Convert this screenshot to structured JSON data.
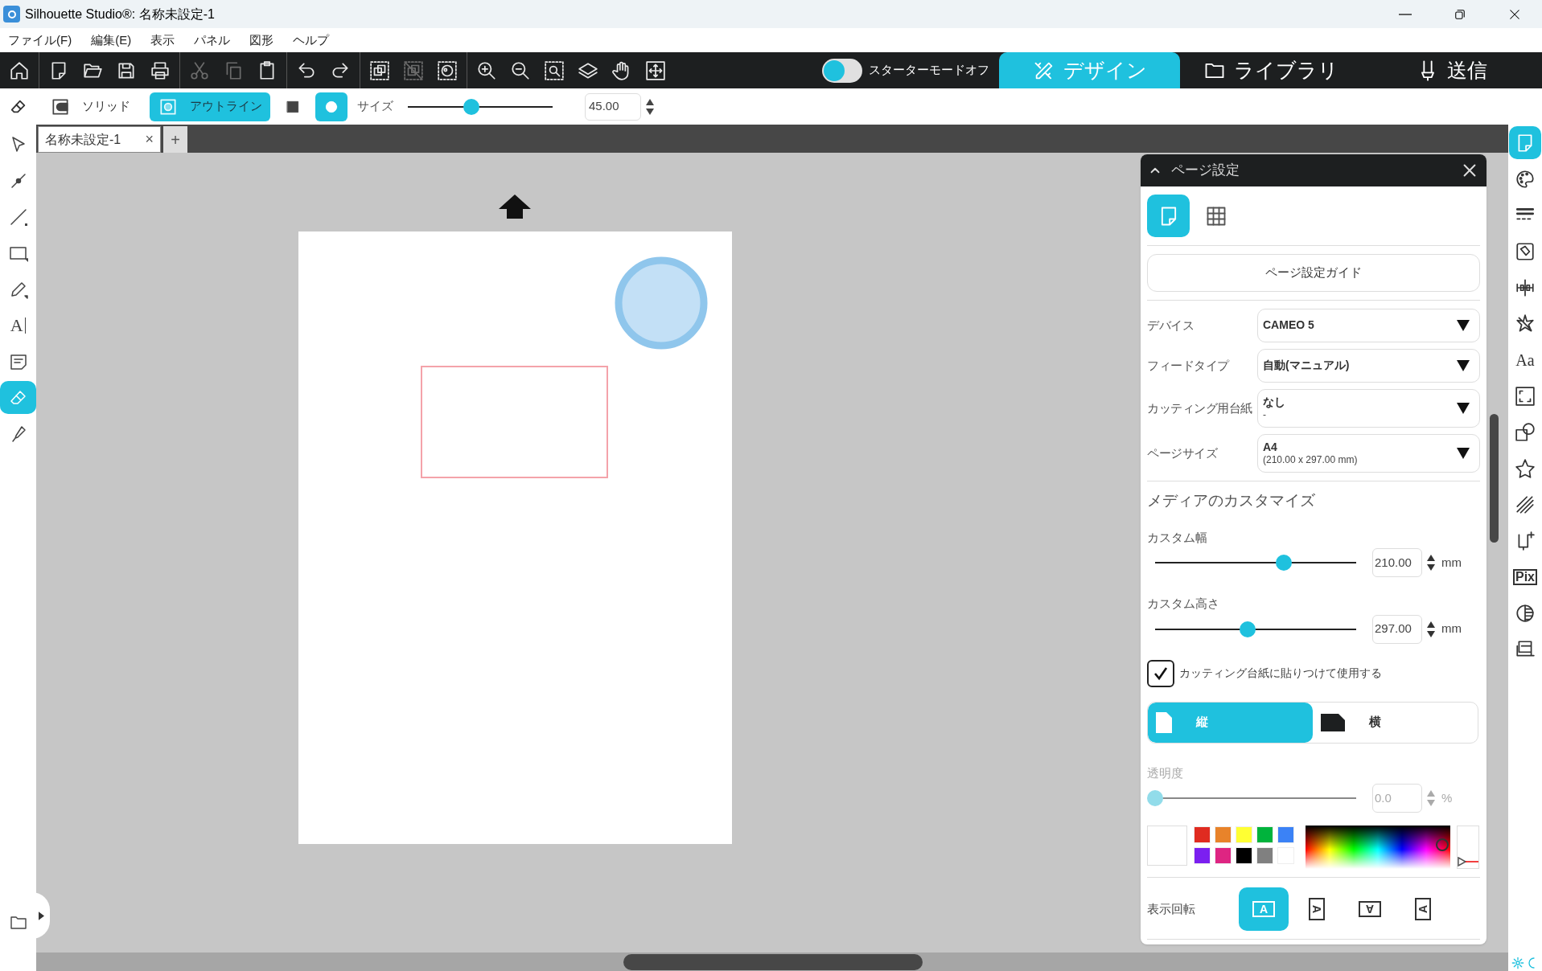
{
  "window": {
    "title": "Silhouette Studio®: 名称未設定-1"
  },
  "menu": [
    "ファイル(F)",
    "編集(E)",
    "表示",
    "パネル",
    "図形",
    "ヘルプ"
  ],
  "toolbar": [
    [
      {
        "kind": "home",
        "disabled": false
      }
    ],
    [
      {
        "kind": "new",
        "disabled": false
      },
      {
        "kind": "open",
        "disabled": false
      },
      {
        "kind": "save",
        "disabled": false
      },
      {
        "kind": "print",
        "disabled": false
      }
    ],
    [
      {
        "kind": "cut",
        "disabled": true
      },
      {
        "kind": "copy",
        "disabled": true
      },
      {
        "kind": "paste",
        "disabled": false
      }
    ],
    [
      {
        "kind": "undo",
        "disabled": false
      },
      {
        "kind": "redo",
        "disabled": false
      }
    ],
    [
      {
        "kind": "group",
        "disabled": false
      },
      {
        "kind": "ungroup",
        "disabled": true
      },
      {
        "kind": "compound",
        "disabled": false
      }
    ],
    [
      {
        "kind": "zoomin",
        "disabled": false
      },
      {
        "kind": "zoomout",
        "disabled": false
      },
      {
        "kind": "zoomsel",
        "disabled": false
      },
      {
        "kind": "flip",
        "disabled": false
      },
      {
        "kind": "hand",
        "disabled": false
      },
      {
        "kind": "fit",
        "disabled": false
      }
    ]
  ],
  "starter_mode": {
    "label": "スターターモードオフ",
    "on": false
  },
  "main_tabs": [
    {
      "kind": "design",
      "label": "デザイン",
      "selected": true
    },
    {
      "kind": "library",
      "label": "ライブラリ",
      "selected": false
    },
    {
      "kind": "send",
      "label": "送信",
      "selected": false
    }
  ],
  "eraser_options": {
    "styles": [
      {
        "kind": "solid",
        "label": "ソリッド",
        "selected": false
      },
      {
        "kind": "outline",
        "label": "アウトライン",
        "selected": true
      }
    ],
    "shapes": [
      {
        "kind": "square",
        "selected": false
      },
      {
        "kind": "circle",
        "selected": true
      }
    ],
    "size": {
      "label": "サイズ",
      "level": 0.44,
      "value": "45.00"
    }
  },
  "document_tabs": [
    {
      "label": "名称未設定-1",
      "close": "×"
    }
  ],
  "add_tab": "+",
  "tools": [
    {
      "kind": "select",
      "selected": false
    },
    {
      "kind": "node",
      "selected": false
    },
    {
      "kind": "line",
      "selected": false
    },
    {
      "kind": "rect",
      "selected": false
    },
    {
      "kind": "pencil",
      "selected": false
    },
    {
      "kind": "text",
      "glyph": "A",
      "selected": false
    },
    {
      "kind": "note",
      "selected": false
    },
    {
      "kind": "eraser",
      "selected": true
    },
    {
      "kind": "knife",
      "selected": false
    }
  ],
  "canvas": {
    "objects": [
      {
        "kind": "circle",
        "color": "#8fc6ec"
      },
      {
        "kind": "rectangle",
        "color": "#f4a3aa"
      }
    ]
  },
  "page_setup_panel": {
    "title": "ページ設定",
    "expanded": true,
    "views": [
      {
        "kind": "page",
        "selected": true
      },
      {
        "kind": "grid",
        "selected": false
      }
    ],
    "guide_button": "ページ設定ガイド",
    "fields": [
      {
        "label": "デバイス",
        "value": "CAMEO 5"
      },
      {
        "label": "フィードタイプ",
        "value": "自動(マニュアル)"
      },
      {
        "label": "カッティング用台紙",
        "value": "なし",
        "detail": "-"
      },
      {
        "label": "ページサイズ",
        "value": "A4",
        "detail": "(210.00 x 297.00 mm)"
      }
    ],
    "section_title": "メディアのカスタマイズ",
    "sliders": [
      {
        "label": "カスタム幅",
        "level": 0.64,
        "value": "210.00",
        "unit": "mm"
      },
      {
        "label": "カスタム高さ",
        "level": 0.46,
        "value": "297.00",
        "unit": "mm"
      }
    ],
    "mat_checkbox": {
      "label": "カッティング台紙に貼りつけて使用する",
      "checked": true
    },
    "orientation": [
      {
        "kind": "portrait",
        "label": "縦",
        "selected": true
      },
      {
        "kind": "landscape",
        "label": "横",
        "selected": false
      }
    ],
    "opacity": {
      "label": "透明度",
      "level": 0,
      "value": "0.0",
      "unit": "%",
      "disabled": true
    },
    "current_color": {
      "color": "#ffffff"
    },
    "swatches": [
      {
        "color": "#e02b20"
      },
      {
        "color": "#e8832a"
      },
      {
        "color": "#ffff33"
      },
      {
        "color": "#00b33c"
      },
      {
        "color": "#3b82f6"
      },
      {
        "color": "#7b1ff0"
      },
      {
        "color": "#de2582"
      },
      {
        "color": "#000000"
      },
      {
        "color": "#808080"
      },
      {
        "color": "#ffffff"
      }
    ],
    "rotation": {
      "label": "表示回転",
      "options": [
        {
          "kind": "up",
          "glyph": "A",
          "selected": true
        },
        {
          "kind": "right",
          "glyph": "A",
          "selected": false
        },
        {
          "kind": "down",
          "glyph": "A",
          "selected": false
        },
        {
          "kind": "left",
          "glyph": "A",
          "selected": false
        }
      ]
    }
  },
  "side_panels": [
    {
      "kind": "page",
      "selected": true
    },
    {
      "kind": "palette",
      "selected": false
    },
    {
      "kind": "linestyle",
      "selected": false
    },
    {
      "kind": "fill",
      "selected": false
    },
    {
      "kind": "align",
      "selected": false
    },
    {
      "kind": "transform",
      "selected": false
    },
    {
      "kind": "textstyle",
      "glyph": "Aa",
      "selected": false
    },
    {
      "kind": "scale",
      "selected": false
    },
    {
      "kind": "modify",
      "selected": false
    },
    {
      "kind": "star",
      "selected": false
    },
    {
      "kind": "sketch",
      "selected": false
    },
    {
      "kind": "trace",
      "selected": false
    },
    {
      "kind": "pixscan",
      "glyph": "Pix",
      "selected": false
    },
    {
      "kind": "contrast",
      "selected": false
    },
    {
      "kind": "layers",
      "selected": false
    }
  ]
}
